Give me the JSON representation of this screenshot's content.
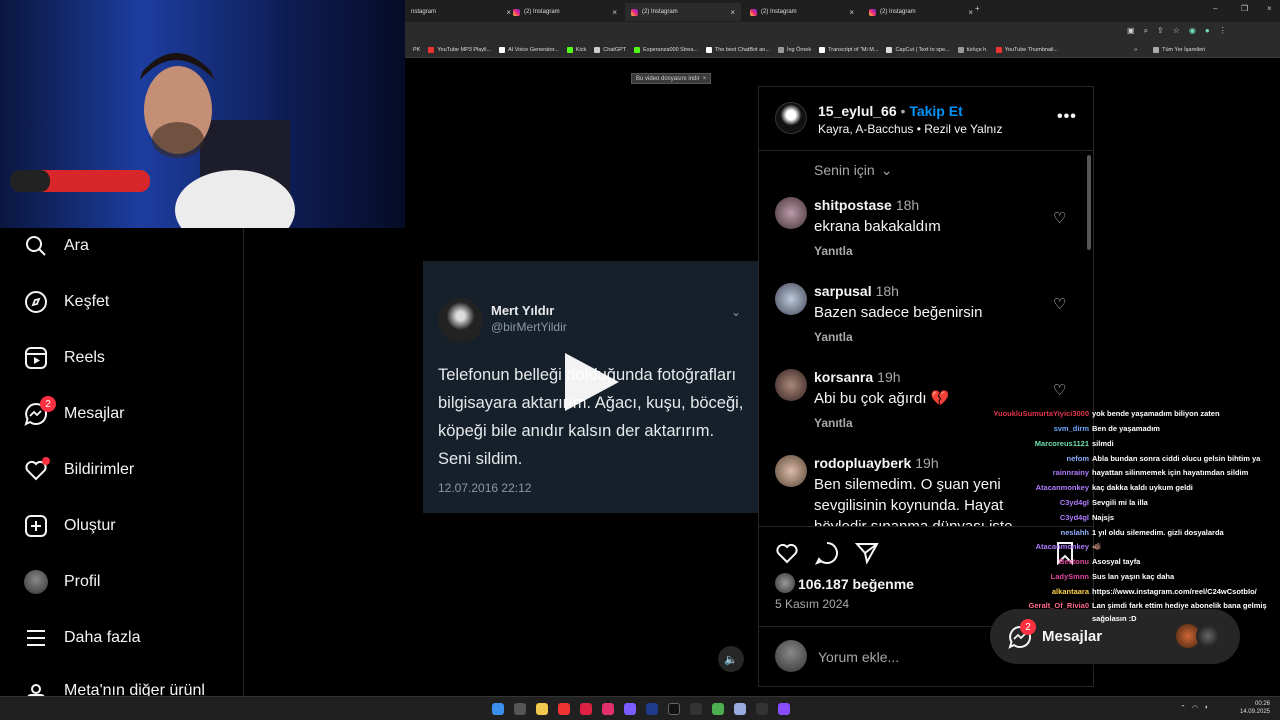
{
  "browser": {
    "tabs": [
      {
        "label": "nstagram"
      },
      {
        "label": "(2) Instagram"
      },
      {
        "label": "(2) Instagram"
      },
      {
        "label": "(2) Instagram"
      },
      {
        "label": "(2) Instagram"
      }
    ],
    "new_tab": "+",
    "bookmarks": [
      "PK",
      "YouTube MP3 Playli...",
      "AI Voice Generator...",
      "Kick",
      "ChatGPT",
      "Esperanza000 Strea...",
      "The best ChatBot an...",
      "İng Örnek",
      "Transcript of \"Mi M...",
      "CapCut | Text to spe...",
      "türkçe h.",
      "YouTube Thumbnail..."
    ],
    "bookmarks_more": "»",
    "all_bookmarks": "Tüm Yer İşaretleri",
    "download_notice": "Bu video dosyasını indir"
  },
  "sidebar": {
    "items": [
      {
        "label": "Ara",
        "icon": "search-icon"
      },
      {
        "label": "Keşfet",
        "icon": "compass-icon"
      },
      {
        "label": "Reels",
        "icon": "reels-icon"
      },
      {
        "label": "Mesajlar",
        "icon": "messenger-icon",
        "badge": "2"
      },
      {
        "label": "Bildirimler",
        "icon": "heart-icon"
      },
      {
        "label": "Oluştur",
        "icon": "plus-square-icon"
      },
      {
        "label": "Profil",
        "icon": "avatar"
      },
      {
        "label": "Daha fazla",
        "icon": "menu-icon"
      },
      {
        "label": "Meta'nın diğer ürünl",
        "icon": "meta-icon"
      }
    ]
  },
  "tweet": {
    "name": "Mert Yıldır",
    "handle": "@birMertYildir",
    "body": "Telefonun belleği dolduğunda fotoğrafları bilgisayara aktarırım. Ağacı, kuşu, böceği, köpeği bile anıdır kalsın der aktarırım. Seni sildim.",
    "date": "12.07.2016 22:12"
  },
  "post": {
    "username": "15_eylul_66",
    "follow": "Takip Et",
    "separator": "•",
    "audio": "Kayra, A-Bacchus • Rezil ve Yalnız",
    "sort_label": "Senin için",
    "likes": "106.187 beğenme",
    "date": "5 Kasım 2024",
    "comment_placeholder": "Yorum ekle..."
  },
  "comments": [
    {
      "user": "shitpostase",
      "time": "18h",
      "text": "ekrana bakakaldım",
      "reply": "Yanıtla"
    },
    {
      "user": "sarpusal",
      "time": "18h",
      "text": "Bazen sadece beğenirsin",
      "reply": "Yanıtla"
    },
    {
      "user": "korsanra",
      "time": "19h",
      "text": "Abi bu çok ağırdı 💔",
      "reply": "Yanıtla"
    },
    {
      "user": "rodopluayberk",
      "time": "19h",
      "text": "Ben silemedim. O şuan yeni sevgilisinin koynunda. Hayat böyledir sınanma dünyası işte",
      "reply": ""
    }
  ],
  "messages_popup": {
    "label": "Mesajlar",
    "badge": "2"
  },
  "chat": [
    {
      "name": "YuoukluSumurtaYiyici3000",
      "color": "#e0334a",
      "msg": "yok bende yaşamadım biliyon zaten"
    },
    {
      "name": "svm_dirm",
      "color": "#6fa8ff",
      "msg": "Ben de yaşamadım"
    },
    {
      "name": "Marcoreus1121",
      "color": "#6fe0b0",
      "msg": "silmdi"
    },
    {
      "name": "nefom",
      "color": "#8fb0ff",
      "msg": "Abla bundan sonra ciddi olucu gelsin bihtim ya"
    },
    {
      "name": "rainnrainy",
      "color": "#b07cff",
      "msg": "hayattan silinmemek için hayatımdan sildim"
    },
    {
      "name": "Atacanmonkey",
      "color": "#b07cff",
      "msg": "kaç dakka kaldı uykum geldi"
    },
    {
      "name": "C3yd4gl",
      "color": "#b07cff",
      "msg": "Sevgili mi la illa"
    },
    {
      "name": "C3yd4gl",
      "color": "#b07cff",
      "msg": "Najsjs"
    },
    {
      "name": "neslahh",
      "color": "#8fb0ff",
      "msg": "1 yıl oldu silemedim. gizli dosyalarda"
    },
    {
      "name": "Atacanmonkey",
      "color": "#b07cff",
      "msg": "🐗"
    },
    {
      "name": "Bestonu",
      "color": "#e04aa0",
      "msg": "Asosyal tayfa"
    },
    {
      "name": "LadySmnn",
      "color": "#e04aa0",
      "msg": "Sus lan yaşın kaç daha"
    },
    {
      "name": "alkantaara",
      "color": "#ffd24a",
      "msg": "https://www.instagram.com/reel/C24wCsotbIo/"
    },
    {
      "name": "Geralt_Of_Rivia0",
      "color": "#ff6a8a",
      "msg": "Lan şimdi fark ettim hediye abonelik bana gelmiş"
    },
    {
      "name": "",
      "color": "#ffffff",
      "msg": "sağolasın :D"
    }
  ],
  "taskbar": {
    "time": "00:26",
    "date": "14.09.2025"
  },
  "colors": {
    "accent": "#0095f6",
    "notification": "#ff3040",
    "background": "#000000"
  }
}
